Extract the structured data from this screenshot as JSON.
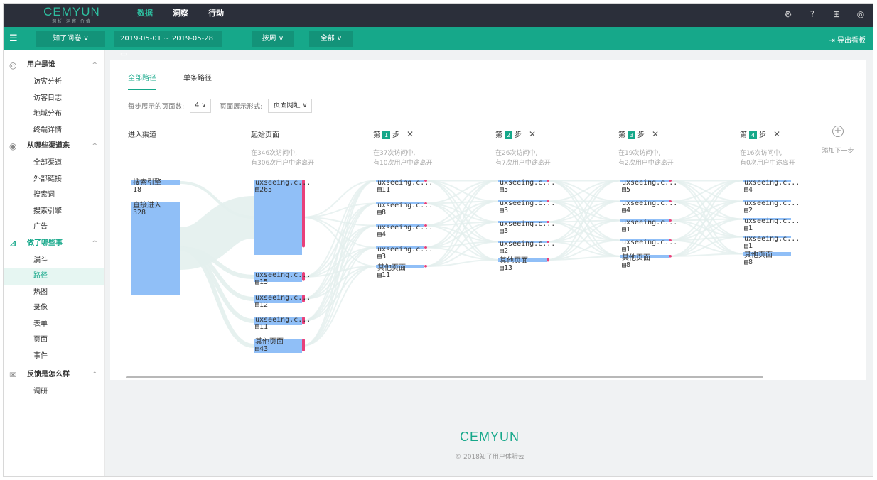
{
  "app": {
    "logo": "CEMYUN",
    "logo_sub": "洞析 洞察 价值",
    "accent": "#16a88a"
  },
  "topnav": [
    "数据",
    "洞察",
    "行动"
  ],
  "toolbar": {
    "project": "知了问卷 ∨",
    "date_range": "2019-05-01 ~ 2019-05-28",
    "granularity": "按周 ∨",
    "filter": "全部 ∨",
    "export": "导出看板"
  },
  "sidebar": {
    "sections": [
      {
        "title": "用户是谁",
        "items": [
          "访客分析",
          "访客日志",
          "地域分布",
          "终端详情"
        ]
      },
      {
        "title": "从哪些渠道来",
        "items": [
          "全部渠道",
          "外部链接",
          "搜索词",
          "搜索引擎",
          "广告"
        ]
      },
      {
        "title": "做了哪些事",
        "items": [
          "漏斗",
          "路径",
          "热图",
          "录像",
          "表单",
          "页面",
          "事件"
        ]
      },
      {
        "title": "反馈是怎么样",
        "items": [
          "调研"
        ]
      }
    ],
    "active_item": "路径"
  },
  "tabs": [
    "全部路径",
    "单条路径"
  ],
  "options": {
    "pages_per_step_label": "每步展示的页面数:",
    "pages_per_step_value": "4 ∨",
    "display_label": "页面展示形式:",
    "display_value": "页面网址 ∨"
  },
  "columns": {
    "entry": "进入渠道",
    "start": "起始页面",
    "start_sub1": "在346次访问中,",
    "start_sub2": "有306次用户中途离开",
    "step_prefix": "第",
    "step_suffix": "步",
    "steps": [
      {
        "n": "1",
        "sub1": "在37次访问中,",
        "sub2": "有10次用户中途离开"
      },
      {
        "n": "2",
        "sub1": "在26次访问中,",
        "sub2": "有7次用户中途离开"
      },
      {
        "n": "3",
        "sub1": "在19次访问中,",
        "sub2": "有2次用户中途离开"
      },
      {
        "n": "4",
        "sub1": "在16次访问中,",
        "sub2": "有0次用户中途离开"
      }
    ],
    "add_step": "添加下一步"
  },
  "flow": {
    "entry": [
      {
        "label": "搜索引擎",
        "count": "18"
      },
      {
        "label": "直接进入",
        "count": "328"
      }
    ],
    "start": [
      {
        "label": "uxseeing.c...",
        "count": "265"
      },
      {
        "label": "uxseeing.c...",
        "count": "15"
      },
      {
        "label": "uxseeing.c...",
        "count": "12"
      },
      {
        "label": "uxseeing.c...",
        "count": "11"
      },
      {
        "label": "其他页面",
        "count": "43"
      }
    ],
    "step1": [
      {
        "label": "uxseeing.c...",
        "count": "11"
      },
      {
        "label": "uxseeing.c...",
        "count": "8"
      },
      {
        "label": "uxseeing.c...",
        "count": "4"
      },
      {
        "label": "uxseeing.c...",
        "count": "3"
      },
      {
        "label": "其他页面",
        "count": "11"
      }
    ],
    "step2": [
      {
        "label": "uxseeing.c...",
        "count": "5"
      },
      {
        "label": "uxseeing.c...",
        "count": "3"
      },
      {
        "label": "uxseeing.c...",
        "count": "3"
      },
      {
        "label": "uxseeing.c...",
        "count": "2"
      },
      {
        "label": "其他页面",
        "count": "13"
      }
    ],
    "step3": [
      {
        "label": "uxseeing.c...",
        "count": "5"
      },
      {
        "label": "uxseeing.c...",
        "count": "4"
      },
      {
        "label": "uxseeing.c...",
        "count": "1"
      },
      {
        "label": "uxseeing.c...",
        "count": "1"
      },
      {
        "label": "其他页面",
        "count": "8"
      }
    ],
    "step4": [
      {
        "label": "uxseeing.c...",
        "count": "4"
      },
      {
        "label": "uxseeing.c...",
        "count": "2"
      },
      {
        "label": "uxseeing.c...",
        "count": "1"
      },
      {
        "label": "uxseeing.c...",
        "count": "1"
      },
      {
        "label": "其他页面",
        "count": "8"
      }
    ],
    "colors": {
      "node": "#90bff7",
      "exit": "#e8407a",
      "link": "#e3efed"
    }
  },
  "footer": {
    "logo": "CEMYUN",
    "copyright": "© 2018知了用户体验云"
  }
}
